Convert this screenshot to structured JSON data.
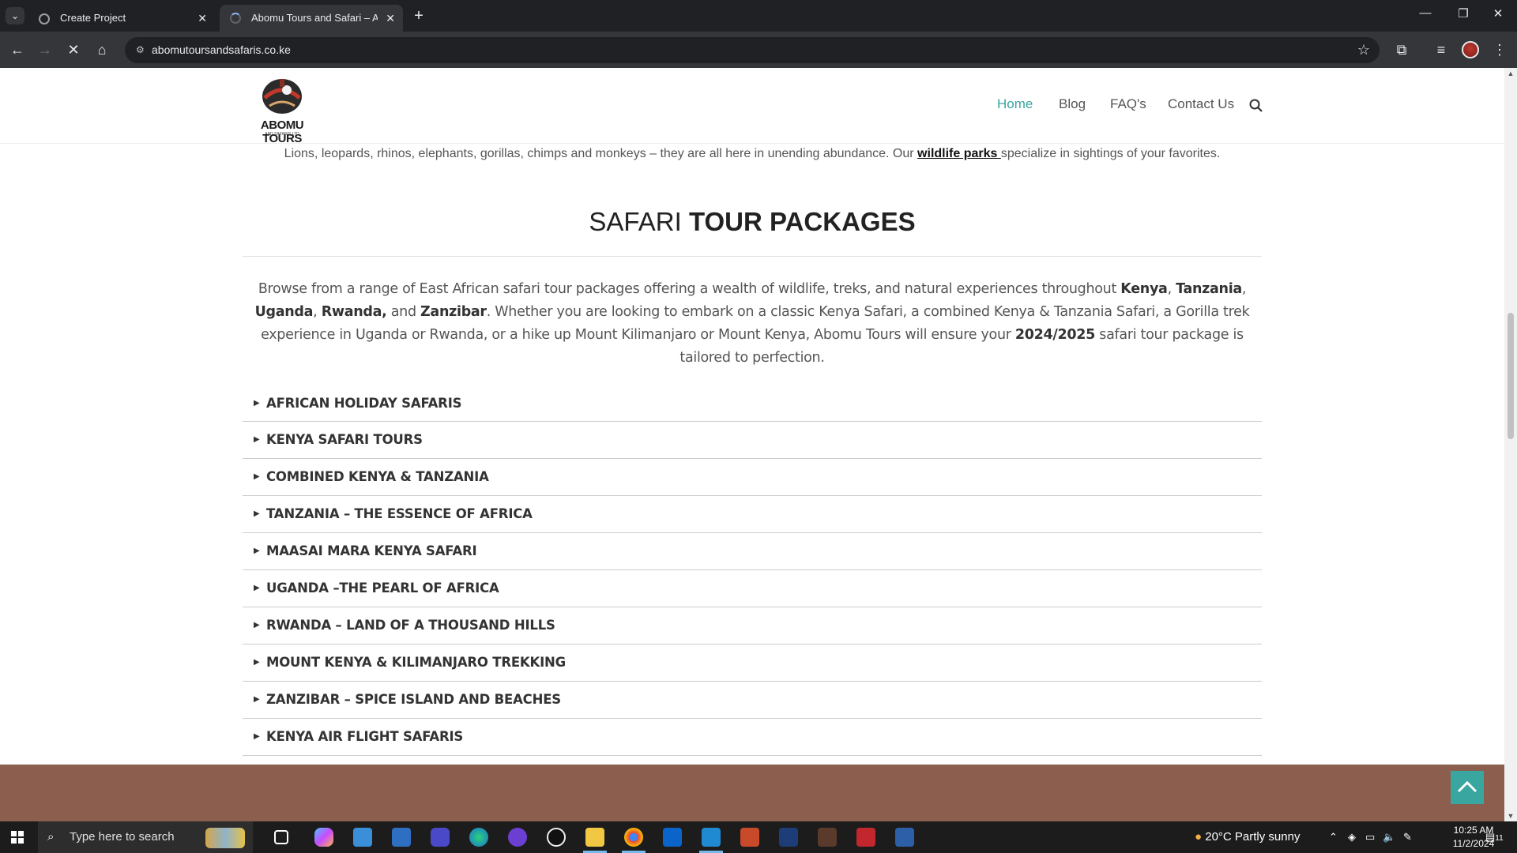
{
  "browser": {
    "tabs": [
      {
        "title": "Create Project",
        "active": false
      },
      {
        "title": "Abomu Tours and Safari – Abomu",
        "active": true
      }
    ],
    "url": "abomutoursandsafaris.co.ke"
  },
  "site": {
    "logo": {
      "brand": "ABOMU TOURS",
      "sub": "AND SAFARIS LTD"
    },
    "nav": {
      "home": "Home",
      "blog": "Blog",
      "faqs": "FAQ's",
      "contact": "Contact Us"
    },
    "accent_color": "#3aa6a0",
    "footer_color": "#8b5e4d"
  },
  "intro": {
    "text_before": "Lions, leopards, rhinos, elephants, gorillas, chimps and monkeys – they are all here in unending abundance. Our ",
    "link": "wildlife parks ",
    "text_after": "specialize in sightings of your favorites."
  },
  "section": {
    "title_light": "SAFARI ",
    "title_bold": "TOUR PACKAGES",
    "desc": {
      "p1": "Browse from a range of East African safari tour packages offering a wealth of wildlife, treks, and natural experiences throughout ",
      "kenya": "Kenya",
      "comma1": ", ",
      "tanzania": "Tanzania",
      "comma2": ", ",
      "uganda": "Uganda",
      "comma3": ", ",
      "rwanda": "Rwanda,",
      "and": " and ",
      "zanzibar": "Zanzibar",
      "p2": ". Whether you are looking to embark on a classic Kenya Safari, a combined Kenya & Tanzania Safari, a Gorilla trek experience in Uganda or Rwanda, or a hike up Mount Kilimanjaro or Mount Kenya, Abomu Tours will ensure your ",
      "year": "2024/2025",
      "p3": " safari tour package is tailored to perfection."
    },
    "packages": [
      "AFRICAN HOLIDAY SAFARIS",
      "KENYA SAFARI TOURS",
      "COMBINED KENYA & TANZANIA",
      "TANZANIA – THE ESSENCE OF AFRICA",
      "MAASAI MARA KENYA SAFARI",
      "UGANDA –THE PEARL OF AFRICA",
      "RWANDA – LAND OF A THOUSAND HILLS",
      "MOUNT KENYA & KILIMANJARO TREKKING",
      "ZANZIBAR – SPICE ISLAND AND BEACHES",
      "KENYA AIR FLIGHT SAFARIS"
    ]
  },
  "taskbar": {
    "search_placeholder": "Type here to search",
    "weather": "20°C  Partly sunny",
    "time": "10:25 AM",
    "date": "11/2/2024",
    "notification_count": "11"
  }
}
